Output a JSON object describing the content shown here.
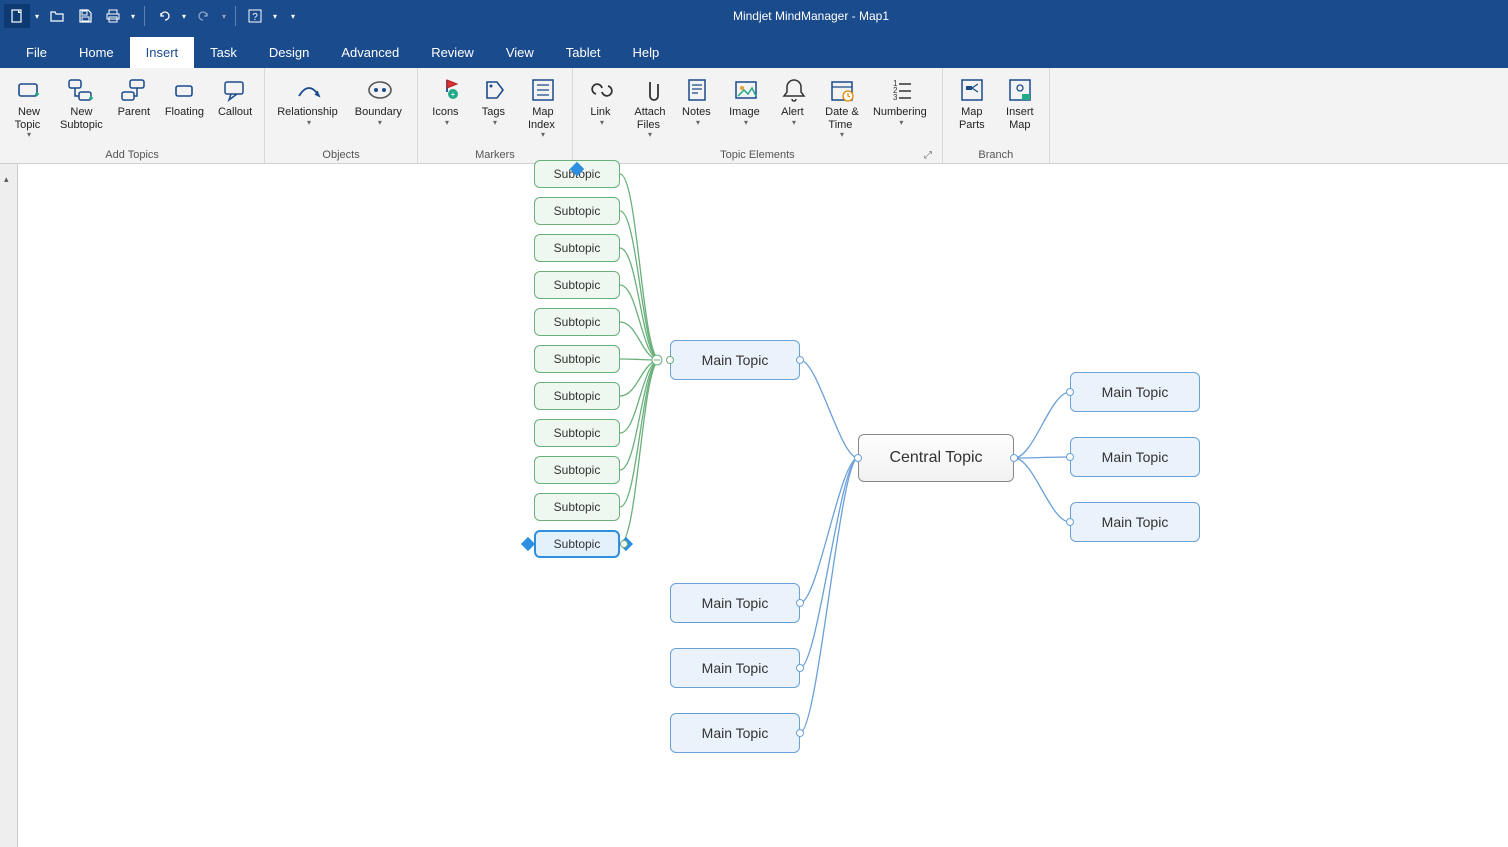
{
  "app_title": "Mindjet MindManager - Map1",
  "tabs": [
    "File",
    "Home",
    "Insert",
    "Task",
    "Design",
    "Advanced",
    "Review",
    "View",
    "Tablet",
    "Help"
  ],
  "active_tab": 2,
  "ribbon": {
    "groups": [
      {
        "label": "Add Topics",
        "buttons": [
          {
            "name": "new-topic",
            "label": "New\nTopic",
            "dropdown": true
          },
          {
            "name": "new-subtopic",
            "label": "New\nSubtopic",
            "dropdown": false
          },
          {
            "name": "parent",
            "label": "Parent",
            "dropdown": false
          },
          {
            "name": "floating",
            "label": "Floating",
            "dropdown": false
          },
          {
            "name": "callout",
            "label": "Callout",
            "dropdown": false
          }
        ]
      },
      {
        "label": "Objects",
        "buttons": [
          {
            "name": "relationship",
            "label": "Relationship",
            "dropdown": true
          },
          {
            "name": "boundary",
            "label": "Boundary",
            "dropdown": true
          }
        ]
      },
      {
        "label": "Markers",
        "buttons": [
          {
            "name": "icons",
            "label": "Icons",
            "dropdown": true
          },
          {
            "name": "tags",
            "label": "Tags",
            "dropdown": true
          },
          {
            "name": "map-index",
            "label": "Map\nIndex",
            "dropdown": true
          }
        ]
      },
      {
        "label": "Topic Elements",
        "launcher": true,
        "buttons": [
          {
            "name": "link",
            "label": "Link",
            "dropdown": true
          },
          {
            "name": "attach-files",
            "label": "Attach\nFiles",
            "dropdown": true
          },
          {
            "name": "notes",
            "label": "Notes",
            "dropdown": true
          },
          {
            "name": "image",
            "label": "Image",
            "dropdown": true
          },
          {
            "name": "alert",
            "label": "Alert",
            "dropdown": true
          },
          {
            "name": "date-time",
            "label": "Date &\nTime",
            "dropdown": true
          },
          {
            "name": "numbering",
            "label": "Numbering",
            "dropdown": true
          }
        ]
      },
      {
        "label": "Branch",
        "buttons": [
          {
            "name": "map-parts",
            "label": "Map\nParts",
            "dropdown": false
          },
          {
            "name": "insert-map",
            "label": "Insert\nMap",
            "dropdown": false
          }
        ]
      }
    ]
  },
  "map": {
    "central": "Central Topic",
    "main_topic": "Main Topic",
    "subtopic": "Subtopic",
    "left_main_count": 4,
    "right_main_count": 3,
    "subtopic_count": 11,
    "selected_subtopic_index": 10
  }
}
